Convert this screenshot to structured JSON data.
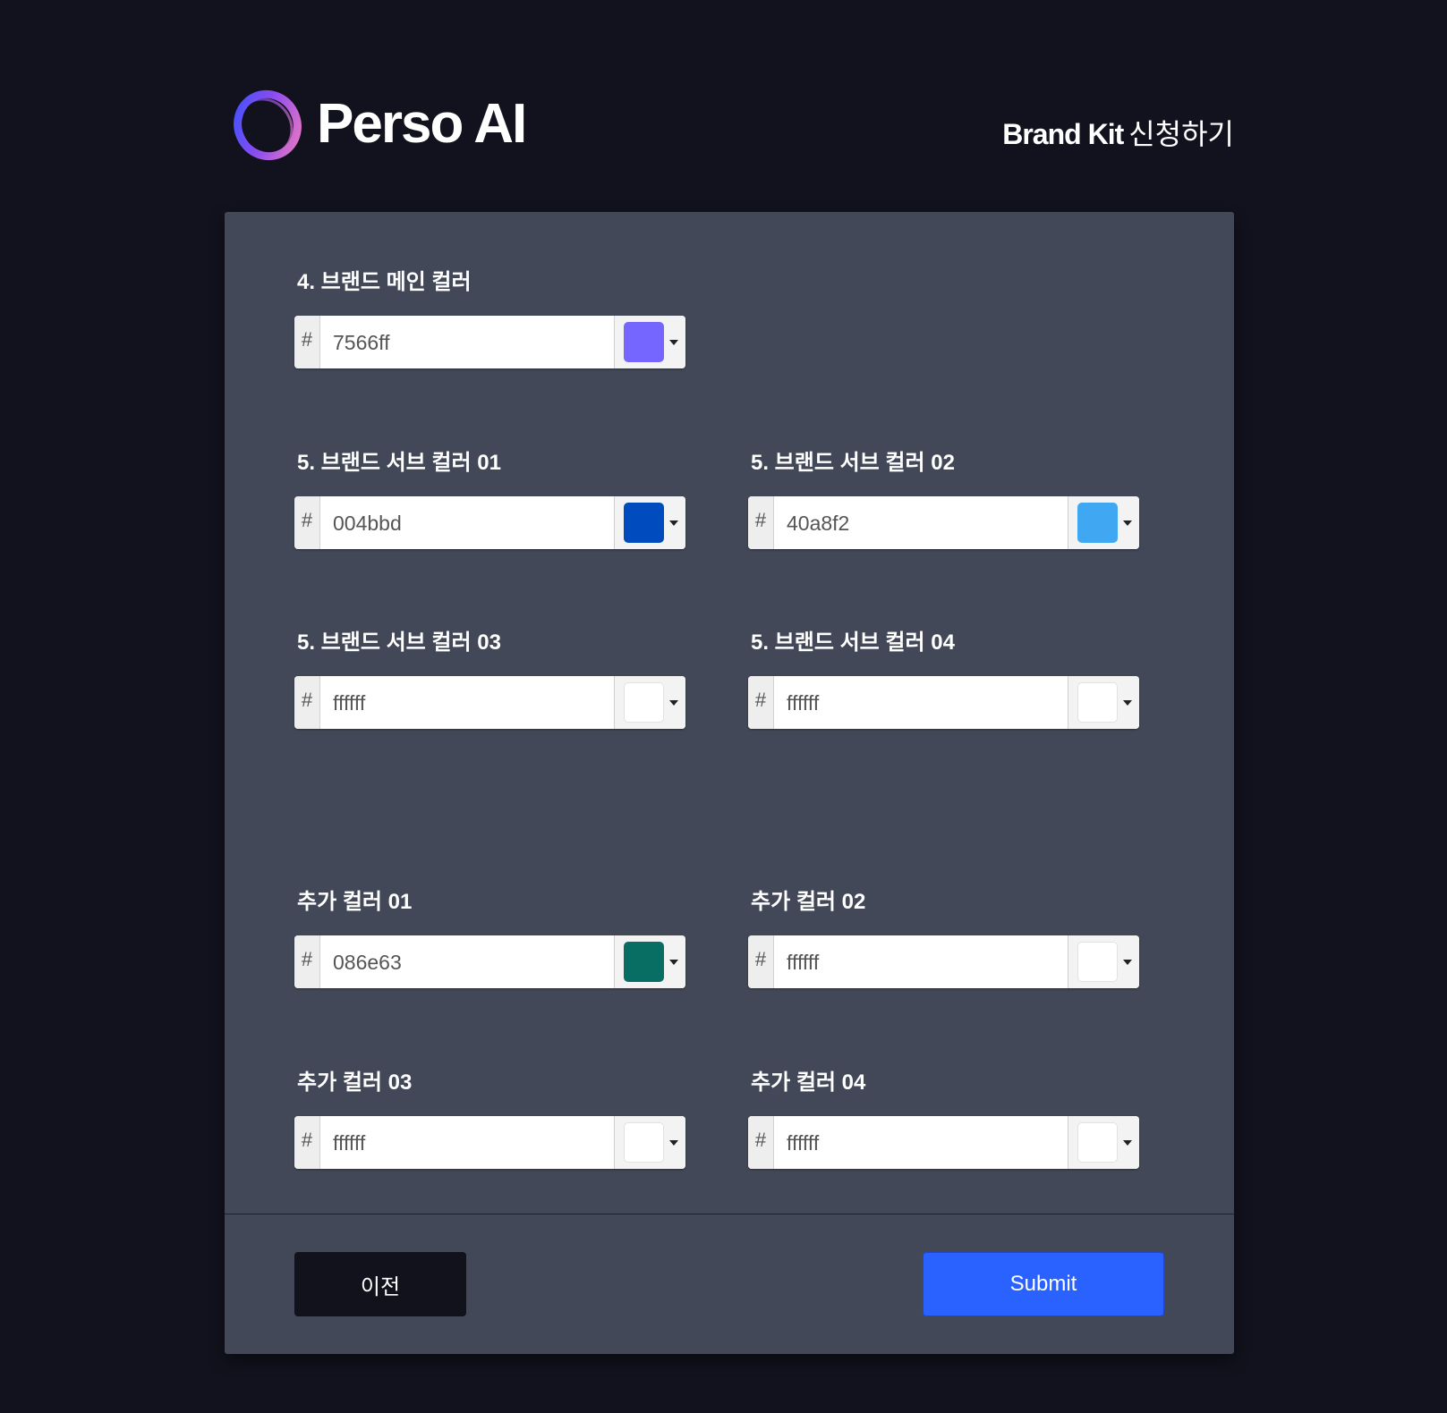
{
  "header": {
    "brand_name": "Perso AI",
    "page_title_bold": "Brand Kit",
    "page_title_rest": "신청하기"
  },
  "fields": {
    "main": {
      "label": "4. 브랜드 메인 컬러",
      "prefix": "#",
      "value": "7566ff",
      "swatch_color": "#7566ff"
    },
    "sub01": {
      "label": "5. 브랜드 서브 컬러 01",
      "prefix": "#",
      "value": "004bbd",
      "swatch_color": "#004bbd"
    },
    "sub02": {
      "label": "5. 브랜드 서브 컬러 02",
      "prefix": "#",
      "value": "40a8f2",
      "swatch_color": "#40a8f2"
    },
    "sub03": {
      "label": "5. 브랜드 서브 컬러 03",
      "prefix": "#",
      "value": "ffffff",
      "swatch_color": "#ffffff"
    },
    "sub04": {
      "label": "5. 브랜드 서브 컬러 04",
      "prefix": "#",
      "value": "ffffff",
      "swatch_color": "#ffffff"
    },
    "extra01": {
      "label": "추가 컬러 01",
      "prefix": "#",
      "value": "086e63",
      "swatch_color": "#086e63"
    },
    "extra02": {
      "label": "추가 컬러 02",
      "prefix": "#",
      "value": "ffffff",
      "swatch_color": "#ffffff"
    },
    "extra03": {
      "label": "추가 컬러 03",
      "prefix": "#",
      "value": "ffffff",
      "swatch_color": "#ffffff"
    },
    "extra04": {
      "label": "추가 컬러 04",
      "prefix": "#",
      "value": "ffffff",
      "swatch_color": "#ffffff"
    }
  },
  "buttons": {
    "prev_label": "이전",
    "submit_label": "Submit"
  },
  "colors": {
    "page_background": "#11121d",
    "card_background": "#424857",
    "submit_button": "#2a62ff",
    "prev_button": "#11121c"
  },
  "icons": {
    "logo": "perso-ring-logo-icon",
    "picker_caret": "caret-down-icon"
  }
}
